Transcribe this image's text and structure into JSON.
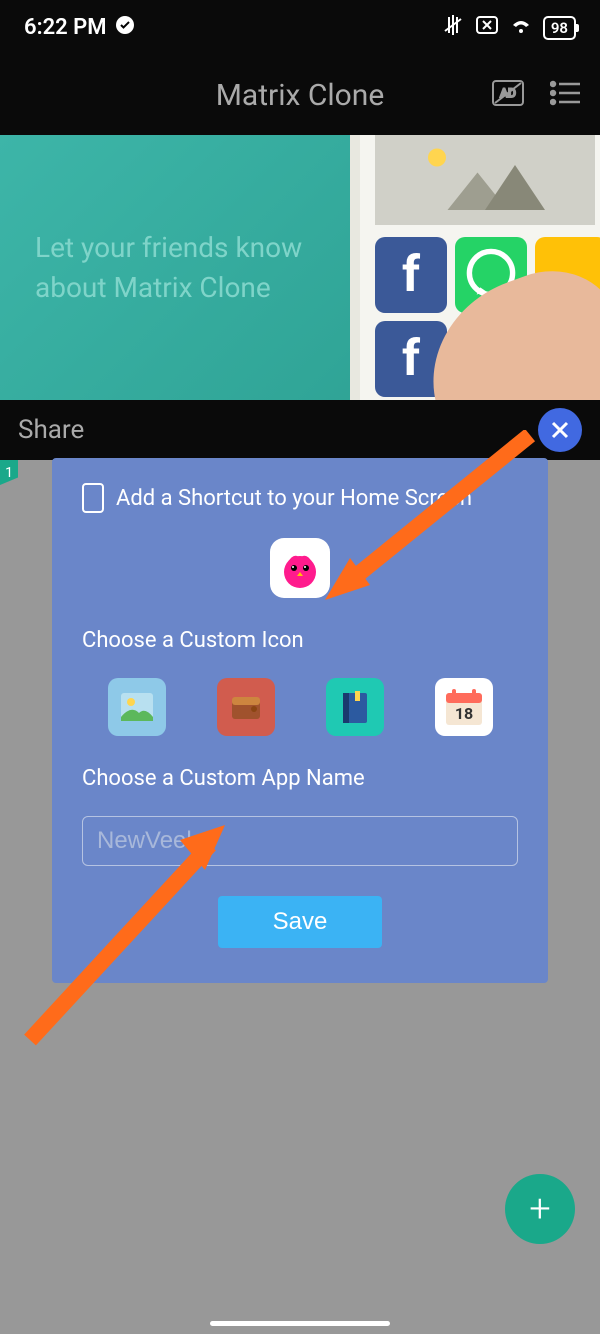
{
  "status": {
    "time": "6:22 PM",
    "battery": "98"
  },
  "header": {
    "title": "Matrix Clone"
  },
  "banner": {
    "line1": "Let your friends know",
    "line2": "about Matrix Clone"
  },
  "share": {
    "label": "Share"
  },
  "modal": {
    "title": "Add a Shortcut to your Home Screen",
    "choose_icon": "Choose a Custom Icon",
    "choose_name": "Choose a Custom App Name",
    "placeholder": "NewVeeka",
    "save": "Save",
    "calendar_day": "18"
  },
  "tab_badge": "1"
}
